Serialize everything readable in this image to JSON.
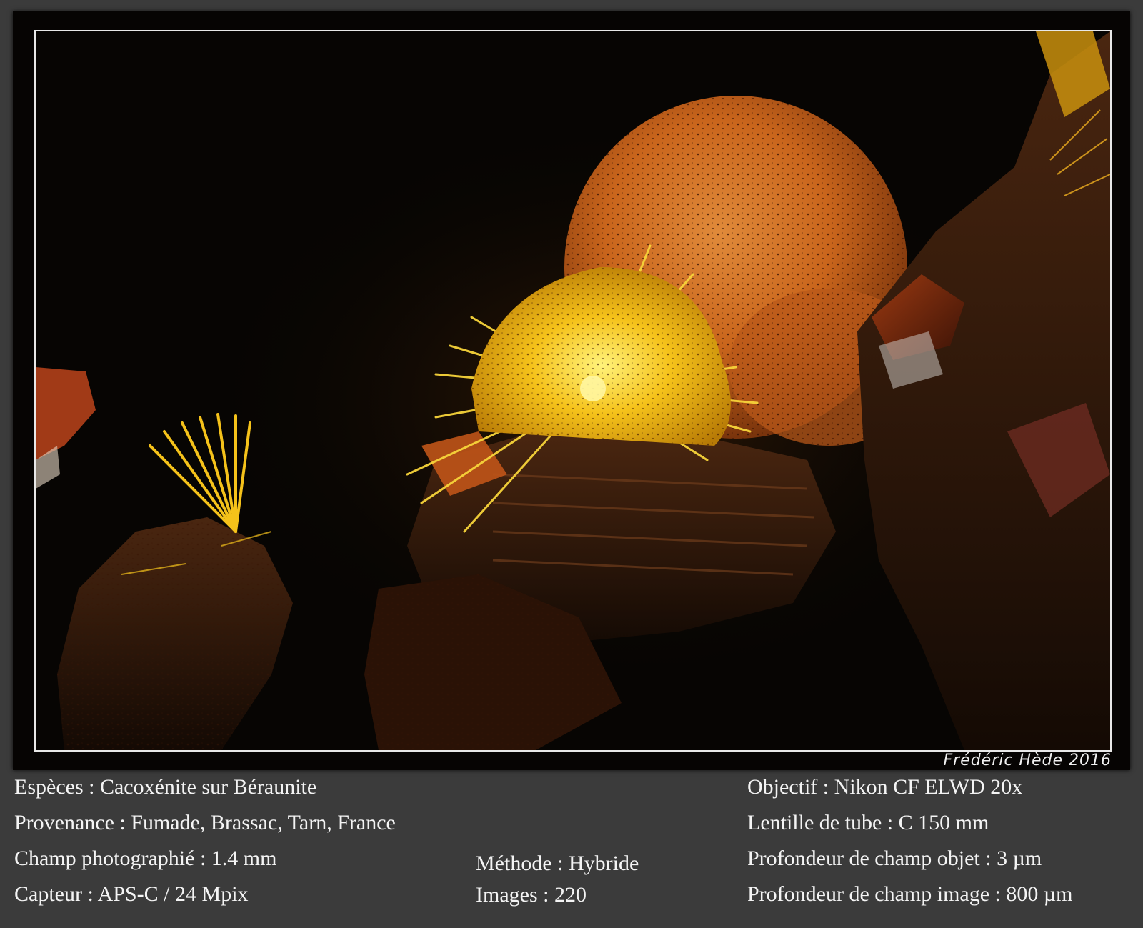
{
  "signature": "Frédéric Hède 2016",
  "info_left": [
    "Espèces : Cacoxénite sur Béraunite",
    "Provenance : Fumade, Brassac, Tarn,  France",
    "Champ photographié : 1.4 mm",
    "Capteur : APS-C / 24 Mpix"
  ],
  "info_middle": [
    "Méthode : Hybride",
    "Images : 220"
  ],
  "info_right": [
    "Objectif : Nikon CF ELWD 20x",
    "Lentille de tube : C 150 mm",
    "Profondeur de champ objet : 3 µm",
    "Profondeur de champ image : 800 µm"
  ],
  "colors": {
    "background": "#3b3b3b",
    "photo_border": "#e8e8e8",
    "cacoxenite_yellow": "#f5c21a",
    "beraunite_orange": "#c96a1e"
  }
}
